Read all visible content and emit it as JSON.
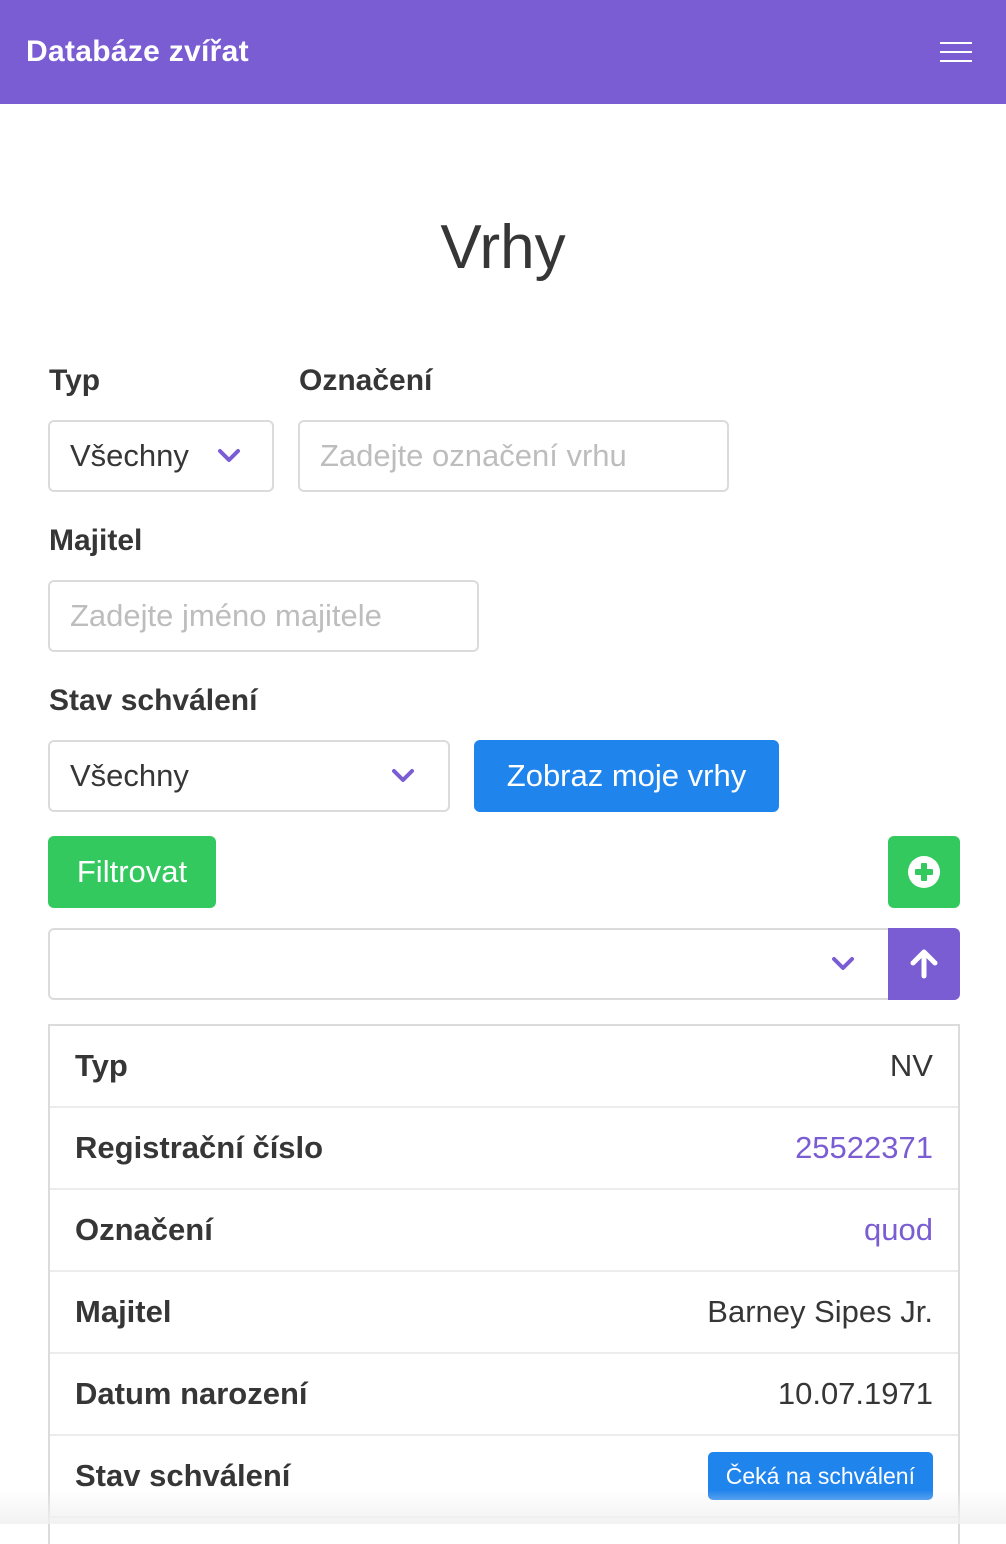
{
  "app": {
    "title": "Databáze zvířat"
  },
  "page": {
    "title": "Vrhy"
  },
  "filters": {
    "type_label": "Typ",
    "type_value": "Všechny",
    "designation_label": "Označení",
    "designation_placeholder": "Zadejte označení vrhu",
    "owner_label": "Majitel",
    "owner_placeholder": "Zadejte jméno majitele",
    "approval_label": "Stav schválení",
    "approval_value": "Všechny",
    "my_litters_button": "Zobraz moje vrhy",
    "filter_button": "Filtrovat"
  },
  "sort": {
    "value": ""
  },
  "record": [
    {
      "key": "Typ",
      "value": "NV"
    },
    {
      "key": "Registrační číslo",
      "value": "25522371"
    },
    {
      "key": "Označení",
      "value": "quod"
    },
    {
      "key": "Majitel",
      "value": "Barney Sipes Jr."
    },
    {
      "key": "Datum narození",
      "value": "10.07.1971"
    },
    {
      "key": "Stav schválení",
      "value": "Čeká na schválení"
    }
  ],
  "icons": {
    "menu": "hamburger-icon",
    "select": "chevron-down-icon",
    "add": "plus-circle-icon",
    "sort": "arrow-up-icon"
  },
  "colors": {
    "primary": "#7a5cd3",
    "info": "#2084ed",
    "success": "#34c95e"
  }
}
